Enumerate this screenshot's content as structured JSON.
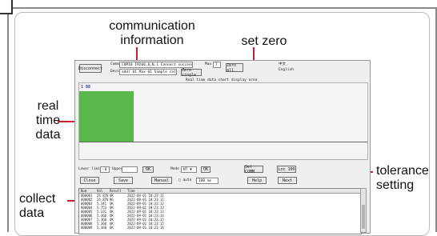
{
  "annotations": {
    "communication_line1": "communication",
    "communication_line2": "information",
    "set_zero": "set zero",
    "real_line1": "real",
    "real_line2": "time",
    "real_line3": "data",
    "tolerance_line1": "tolerance",
    "tolerance_line2": "setting",
    "collect_line1": "collect",
    "collect_line2": "data"
  },
  "app": {
    "disconnect_button": "Disconnect",
    "com_label": "Comm",
    "com_value": "COM10 19200,8,N,1 Connect succeed",
    "max_label": "Max",
    "max_value": "7",
    "zero_all_button": "Zero all",
    "zero_single_button": "Zero single",
    "device_label": "Device",
    "device_value": "addr 01  Max 01  Sample ratio 50Hz",
    "lang_cn": "中文",
    "lang_en": "English",
    "chart_caption": "Real time data chart display area",
    "channel_value": "1 88",
    "lower_label": "Lower limit",
    "lower_value": "-0",
    "upper_label": "Upper",
    "upper_value": "",
    "ok_button1": "OK",
    "mode_label": "Mode",
    "mode_value": "NT",
    "ok_button2": "OK",
    "set_com_button": "Set COMM",
    "tolerance_button": "Loc 100",
    "close_button": "Close",
    "save_button": "Save",
    "manual_button": "Manual",
    "auto_label": "auto",
    "interval_value": "100 ms",
    "help_button": "Help",
    "next_button": "Next"
  },
  "table": {
    "headers": [
      "Num",
      "Val",
      "Result",
      "Time"
    ],
    "rows": [
      [
        "000001",
        "24.870",
        "OK",
        "2022-09-01 10:23:11"
      ],
      [
        "000002",
        "24.870",
        "NG",
        "2022-09-01 10:23:11"
      ],
      [
        "000003",
        "5.341",
        "OK",
        "2022-09-01 10:23:12"
      ],
      [
        "000004",
        "5.753",
        "OK",
        "2022-09-01 10:23:13"
      ],
      [
        "000005",
        "5.331",
        "OK",
        "2022-09-01 10:23:13"
      ],
      [
        "000006",
        "5.360",
        "OK",
        "2022-09-01 10:23:14"
      ],
      [
        "000007",
        "5.360",
        "OK",
        "2022-09-01 10:23:15"
      ],
      [
        "000008",
        "5.360",
        "OK",
        "2022-09-01 10:23:15"
      ],
      [
        "000009",
        "5.360",
        "OK",
        "2022-09-01 10:23:16"
      ]
    ]
  },
  "colors": {
    "bar": "#58b84a",
    "pointer": "#c8232b"
  }
}
